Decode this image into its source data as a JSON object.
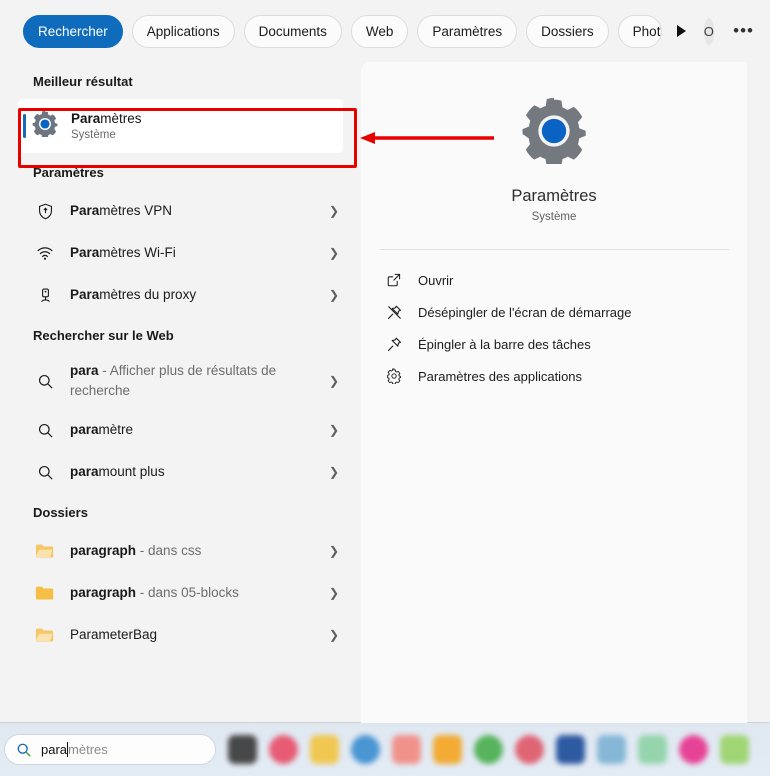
{
  "filters": {
    "chips": [
      {
        "label": "Rechercher",
        "active": true
      },
      {
        "label": "Applications",
        "active": false
      },
      {
        "label": "Documents",
        "active": false
      },
      {
        "label": "Web",
        "active": false
      },
      {
        "label": "Paramètres",
        "active": false
      },
      {
        "label": "Dossiers",
        "active": false
      },
      {
        "label": "Photo",
        "active": false,
        "clipped": true
      }
    ],
    "scroll_arrow": "scroll-right-arrow",
    "avatar_letter": "O",
    "more_label": "•••"
  },
  "best_match": {
    "heading": "Meilleur résultat",
    "title_bold": "Para",
    "title_rest": "mètres",
    "subtitle": "Système"
  },
  "settings_section": {
    "heading": "Paramètres",
    "items": [
      {
        "bold": "Para",
        "rest": "mètres VPN",
        "icon": "shield-icon"
      },
      {
        "bold": "Para",
        "rest": "mètres Wi-Fi",
        "icon": "wifi-icon"
      },
      {
        "bold": "Para",
        "rest": "mètres du proxy",
        "icon": "proxy-icon"
      }
    ]
  },
  "web_section": {
    "heading": "Rechercher sur le Web",
    "items": [
      {
        "bold": "para",
        "rest": "",
        "dim": " - Afficher plus de résultats de recherche",
        "icon": "search-icon"
      },
      {
        "bold": "para",
        "rest": "mètre",
        "dim": "",
        "icon": "search-icon"
      },
      {
        "bold": "para",
        "rest": "mount plus",
        "dim": "",
        "icon": "search-icon"
      }
    ]
  },
  "folders_section": {
    "heading": "Dossiers",
    "items": [
      {
        "bold": "para",
        "rest": "graph",
        "dim": " - dans css",
        "icon": "folder-open-icon"
      },
      {
        "bold": "para",
        "rest": "graph",
        "dim": " - dans 05-blocks",
        "icon": "folder-icon"
      },
      {
        "bold": "Para",
        "rest": "meterBag",
        "dim": "",
        "icon": "folder-open-icon"
      }
    ]
  },
  "preview": {
    "app_icon": "settings-gear-icon",
    "name": "Paramètres",
    "subtitle": "Système",
    "actions": [
      {
        "label": "Ouvrir",
        "icon": "open-external-icon"
      },
      {
        "label": "Désépingler de l'écran de démarrage",
        "icon": "unpin-icon"
      },
      {
        "label": "Épingler à la barre des tâches",
        "icon": "pin-icon"
      },
      {
        "label": "Paramètres des applications",
        "icon": "gear-icon"
      }
    ]
  },
  "taskbar": {
    "search_icon": "search-icon",
    "typed_text": "para",
    "suggestion_text": "mètres",
    "app_colors": [
      "#3b3b3b",
      "#e8516a",
      "#f2c544",
      "#3d8fd0",
      "#f28b82",
      "#f5a623",
      "#4caf50",
      "#e05a6a",
      "#1f4e9c",
      "#7fb3d5",
      "#8fd3a8",
      "#e8368f",
      "#9bd46a"
    ]
  },
  "annotation": {
    "box_color": "#e60000",
    "arrow_color": "#e60000"
  }
}
